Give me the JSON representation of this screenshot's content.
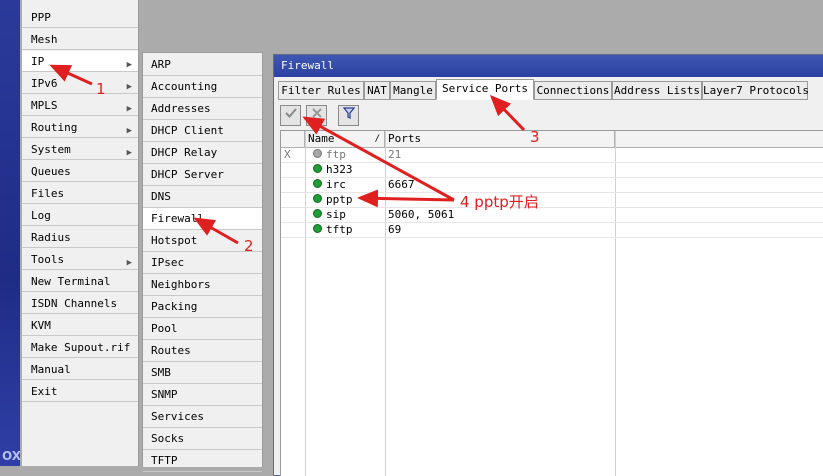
{
  "brand": "OX",
  "menu_main": [
    {
      "label": "PPP",
      "arrow": false
    },
    {
      "label": "Mesh",
      "arrow": false
    },
    {
      "label": "IP",
      "arrow": true,
      "selected": true
    },
    {
      "label": "IPv6",
      "arrow": true
    },
    {
      "label": "MPLS",
      "arrow": true
    },
    {
      "label": "Routing",
      "arrow": true
    },
    {
      "label": "System",
      "arrow": true
    },
    {
      "label": "Queues",
      "arrow": false
    },
    {
      "label": "Files",
      "arrow": false
    },
    {
      "label": "Log",
      "arrow": false
    },
    {
      "label": "Radius",
      "arrow": false
    },
    {
      "label": "Tools",
      "arrow": true
    },
    {
      "label": "New Terminal",
      "arrow": false
    },
    {
      "label": "ISDN Channels",
      "arrow": false
    },
    {
      "label": "KVM",
      "arrow": false
    },
    {
      "label": "Make Supout.rif",
      "arrow": false
    },
    {
      "label": "Manual",
      "arrow": false
    },
    {
      "label": "Exit",
      "arrow": false
    }
  ],
  "menu_ip": [
    {
      "label": "ARP"
    },
    {
      "label": "Accounting"
    },
    {
      "label": "Addresses"
    },
    {
      "label": "DHCP Client"
    },
    {
      "label": "DHCP Relay"
    },
    {
      "label": "DHCP Server"
    },
    {
      "label": "DNS"
    },
    {
      "label": "Firewall",
      "selected": true
    },
    {
      "label": "Hotspot"
    },
    {
      "label": "IPsec"
    },
    {
      "label": "Neighbors"
    },
    {
      "label": "Packing"
    },
    {
      "label": "Pool"
    },
    {
      "label": "Routes"
    },
    {
      "label": "SMB"
    },
    {
      "label": "SNMP"
    },
    {
      "label": "Services"
    },
    {
      "label": "Socks"
    },
    {
      "label": "TFTP"
    }
  ],
  "window": {
    "title": "Firewall",
    "tabs": [
      {
        "label": "Filter Rules"
      },
      {
        "label": "NAT"
      },
      {
        "label": "Mangle"
      },
      {
        "label": "Service Ports",
        "active": true
      },
      {
        "label": "Connections"
      },
      {
        "label": "Address Lists"
      },
      {
        "label": "Layer7 Protocols"
      }
    ],
    "toolbar": {
      "enable_icon": "check-icon",
      "disable_icon": "x-icon",
      "filter_icon": "filter-icon"
    },
    "table": {
      "columns": [
        "Name",
        "Ports"
      ],
      "rows": [
        {
          "flag": "X",
          "name": "ftp",
          "ports": "21",
          "enabled": false
        },
        {
          "flag": "",
          "name": "h323",
          "ports": "",
          "enabled": true
        },
        {
          "flag": "",
          "name": "irc",
          "ports": "6667",
          "enabled": true
        },
        {
          "flag": "",
          "name": "pptp",
          "ports": "",
          "enabled": true
        },
        {
          "flag": "",
          "name": "sip",
          "ports": "5060, 5061",
          "enabled": true
        },
        {
          "flag": "",
          "name": "tftp",
          "ports": "69",
          "enabled": true
        }
      ]
    }
  },
  "annotations": [
    {
      "label": "1"
    },
    {
      "label": "2"
    },
    {
      "label": "3"
    },
    {
      "label": "4 pptp开启"
    }
  ],
  "colors": {
    "title_bar": "#2f46a8",
    "annotation": "#e02020",
    "enabled_dot": "#1e9e34"
  }
}
